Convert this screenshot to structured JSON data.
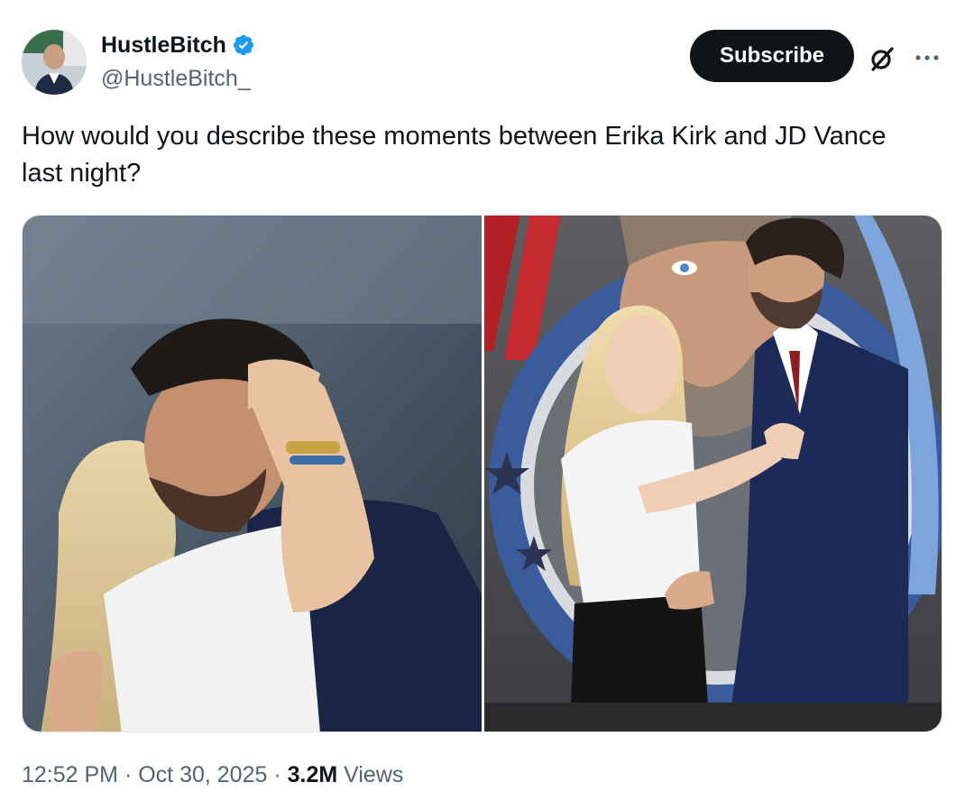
{
  "author": {
    "display_name": "HustleBitch",
    "handle": "@HustleBitch_",
    "verified_icon": "verified-badge-icon"
  },
  "actions": {
    "subscribe_label": "Subscribe",
    "grok_icon": "grok-icon",
    "more_icon": "more-dots-icon"
  },
  "tweet": {
    "text": "How would you describe these moments between Erika Kirk and JD Vance last night?"
  },
  "media": {
    "photos": [
      {
        "alt": "photo-1"
      },
      {
        "alt": "photo-2"
      }
    ]
  },
  "meta": {
    "time": "12:52 PM",
    "separator": " · ",
    "date": "Oct 30, 2025",
    "views_count": "3.2M",
    "views_label": " Views"
  },
  "colors": {
    "text_primary": "#0f1419",
    "text_secondary": "#536471",
    "verified_blue": "#1d9bf0",
    "subscribe_bg": "#0f1419"
  }
}
